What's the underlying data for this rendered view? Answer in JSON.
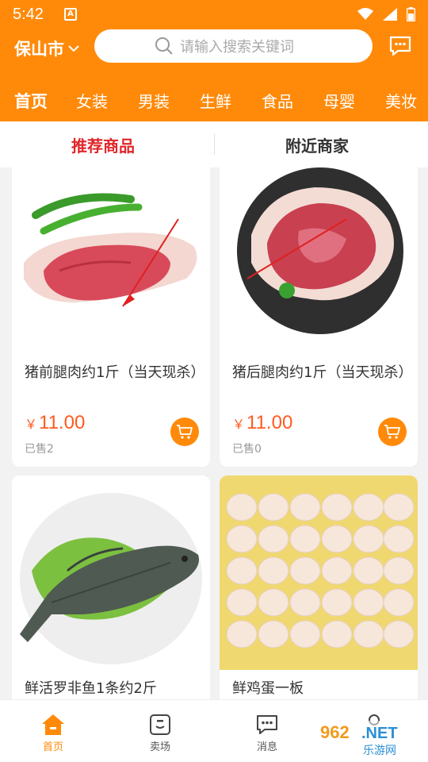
{
  "status": {
    "time": "5:42",
    "notify_icon": "a-icon"
  },
  "header": {
    "city": "保山市",
    "search_placeholder": "请输入搜索关键词"
  },
  "categories": [
    "首页",
    "女装",
    "男装",
    "生鲜",
    "食品",
    "母婴",
    "美妆"
  ],
  "subtabs": {
    "recommended": "推荐商品",
    "nearby": "附近商家"
  },
  "products": [
    {
      "name": "猪前腿肉约1斤（当天现杀）",
      "price_symbol": "￥",
      "price": "11.00",
      "sold": "已售2"
    },
    {
      "name": "猪后腿肉约1斤（当天现杀）",
      "price_symbol": "￥",
      "price": "11.00",
      "sold": "已售0"
    },
    {
      "name": "鲜活罗非鱼1条约2斤"
    },
    {
      "name": "鲜鸡蛋一板"
    }
  ],
  "nav": [
    "首页",
    "卖场",
    "消息"
  ],
  "watermark": {
    "main": "962.NET",
    "sub": "乐游网"
  },
  "colors": {
    "brand": "#ff8a0a",
    "accent_red": "#e0262a",
    "price": "#ff5a1f"
  }
}
